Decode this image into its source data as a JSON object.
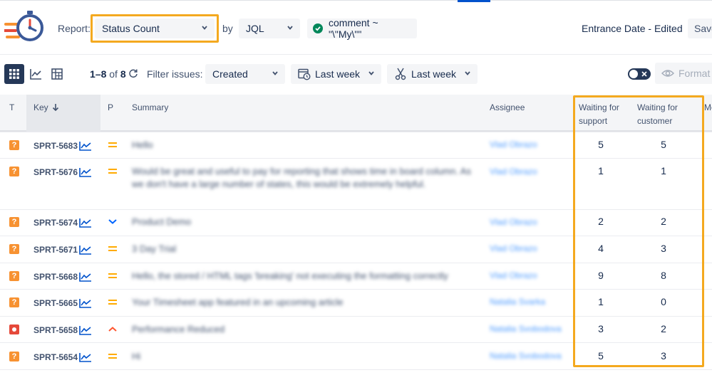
{
  "header": {
    "report_label": "Report:",
    "report_value": "Status Count",
    "by_label": "by",
    "by_value": "JQL",
    "jql_query": "comment ~ \"\\\"My\\\"\"",
    "entrance_label": "Entrance Date - Edited",
    "save_label": "Save"
  },
  "toolbar": {
    "count_range": "1–8",
    "count_of": "of",
    "count_total": "8",
    "filter_label": "Filter issues:",
    "filter_field": "Created",
    "date_filter_1": "Last week",
    "date_filter_2": "Last week",
    "format_label": "Format"
  },
  "table": {
    "headers": {
      "type": "T",
      "key": "Key",
      "priority": "P",
      "summary": "Summary",
      "assignee": "Assignee",
      "waiting_support_1": "Waiting for",
      "waiting_support_2": "support",
      "waiting_customer_1": "Waiting for",
      "waiting_customer_2": "customer",
      "next_col": "Me"
    },
    "rows": [
      {
        "key": "SPRT-5683",
        "type": "question",
        "priority": "medium",
        "summary": "Hello",
        "assignee": "Vlad Obrazo",
        "waiting_support": "5",
        "waiting_customer": "5"
      },
      {
        "key": "SPRT-5676",
        "type": "question",
        "priority": "medium",
        "summary": "Would be great and useful to pay for reporting that shows time in board column. As we don't have a large number of states, this would be extremely helpful.",
        "assignee": "Vlad Obrazo",
        "waiting_support": "1",
        "waiting_customer": "1"
      },
      {
        "key": "SPRT-5674",
        "type": "question",
        "priority": "low",
        "summary": "Product Demo",
        "assignee": "Vlad Obrazo",
        "waiting_support": "2",
        "waiting_customer": "2"
      },
      {
        "key": "SPRT-5671",
        "type": "question",
        "priority": "medium",
        "summary": "3 Day Trial",
        "assignee": "Vlad Obrazo",
        "waiting_support": "4",
        "waiting_customer": "3"
      },
      {
        "key": "SPRT-5668",
        "type": "question",
        "priority": "medium",
        "summary": "Hello, the stored / HTML tags 'breaking' not executing the formatting correctly",
        "assignee": "Vlad Obrazo",
        "waiting_support": "9",
        "waiting_customer": "8"
      },
      {
        "key": "SPRT-5665",
        "type": "question",
        "priority": "medium",
        "summary": "Your Timesheet app featured in an upcoming article",
        "assignee": "Natalia Svarka",
        "waiting_support": "1",
        "waiting_customer": "0"
      },
      {
        "key": "SPRT-5658",
        "type": "bug",
        "priority": "high",
        "summary": "Performance Reduced",
        "assignee": "Natalia Svobodova",
        "waiting_support": "3",
        "waiting_customer": "2"
      },
      {
        "key": "SPRT-5654",
        "type": "question",
        "priority": "medium",
        "summary": "Hi",
        "assignee": "Natalia Svobodova",
        "waiting_support": "5",
        "waiting_customer": "3"
      }
    ]
  },
  "colors": {
    "highlight": "#f4a91f",
    "link": "#0052cc",
    "question_type": "#f79232",
    "bug_type": "#e5493a",
    "medium_priority": "#ffab00",
    "low_priority": "#0065ff",
    "high_priority": "#ff5630"
  },
  "icons": {
    "logo": "stopwatch-logo",
    "grid_view": "grid-icon",
    "chart_view": "line-chart-icon",
    "pivot_view": "pivot-grid-icon",
    "refresh": "refresh-icon",
    "calendar": "calendar-clock-icon",
    "scissors": "scissors-icon",
    "eye": "eye-icon",
    "trend": "trend-icon"
  }
}
